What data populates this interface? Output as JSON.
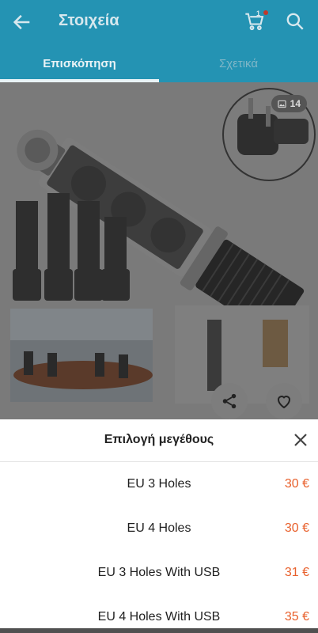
{
  "header": {
    "title": "Στοιχεία",
    "cart_count": "1"
  },
  "tabs": [
    {
      "label": "Επισκόπηση",
      "active": true
    },
    {
      "label": "Σχετικά",
      "active": false
    }
  ],
  "gallery": {
    "image_count": "14"
  },
  "sheet": {
    "title": "Επιλογή μεγέθους",
    "options": [
      {
        "label": "EU 3 Holes",
        "price": "30 €"
      },
      {
        "label": "EU 4 Holes",
        "price": "30 €"
      },
      {
        "label": "EU 3 Holes With USB",
        "price": "31 €"
      },
      {
        "label": "EU 4 Holes With USB",
        "price": "35 €"
      }
    ]
  },
  "colors": {
    "brand": "#2493b3",
    "price": "#e8602c"
  }
}
